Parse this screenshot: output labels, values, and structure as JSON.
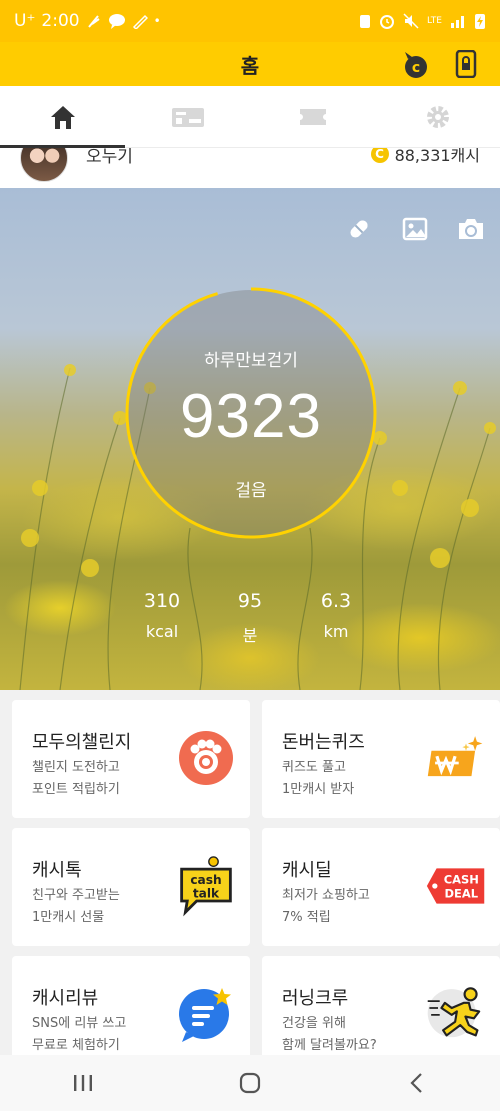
{
  "status_bar": {
    "carrier": "U⁺",
    "time": "2:00",
    "dot": "•",
    "network": "LTE"
  },
  "header": {
    "title": "홈"
  },
  "tabs": [
    {
      "icon": "home-icon",
      "active": true
    },
    {
      "icon": "cashback-card-icon",
      "active": false
    },
    {
      "icon": "ticket-icon",
      "active": false
    },
    {
      "icon": "gear-icon",
      "active": false
    }
  ],
  "profile": {
    "name": "오누기",
    "cash": "88,331캐시",
    "coin_letter": "C"
  },
  "hero": {
    "label": "하루만보걷기",
    "steps": "9323",
    "unit": "걸음",
    "stats": [
      {
        "value": "310",
        "unit": "kcal"
      },
      {
        "value": "95",
        "unit": "분"
      },
      {
        "value": "6.3",
        "unit": "km"
      }
    ]
  },
  "cards": [
    {
      "title": "모두의챌린지",
      "line1": "챌린지 도전하고",
      "line2": "포인트 적립하기",
      "icon": "challenge-paw-icon"
    },
    {
      "title": "돈버는퀴즈",
      "line1": "퀴즈도 풀고",
      "line2": "1만캐시 받자",
      "icon": "quiz-coin-icon"
    },
    {
      "title": "캐시톡",
      "line1": "친구와 주고받는",
      "line2": "1만캐시 선물",
      "icon": "cashtalk-icon",
      "badge_line1": "cash",
      "badge_line2": "talk"
    },
    {
      "title": "캐시딜",
      "line1": "최저가 쇼핑하고",
      "line2": "7% 적립",
      "icon": "cashdeal-icon",
      "badge_line1": "CASH",
      "badge_line2": "DEAL"
    },
    {
      "title": "캐시리뷰",
      "line1": "SNS에 리뷰 쓰고",
      "line2": "무료로 체험하기",
      "icon": "review-chat-icon"
    },
    {
      "title": "러닝크루",
      "line1": "건강을 위해",
      "line2": "함께 달려볼까요?",
      "icon": "running-icon"
    }
  ],
  "colors": {
    "accent": "#ffcc00",
    "ring": "#ffd200",
    "card_title": "#222222"
  }
}
